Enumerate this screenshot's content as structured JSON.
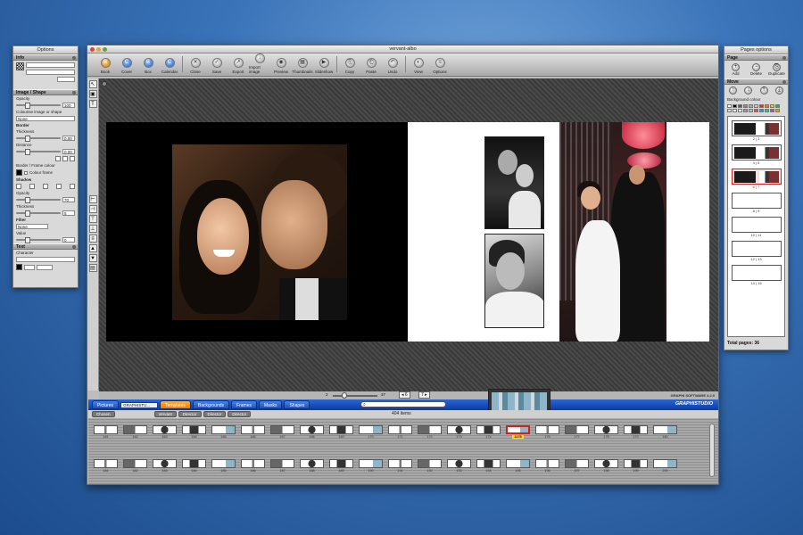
{
  "main_window": {
    "title": "vervant-albo",
    "toolbar": [
      {
        "name": "book",
        "label": "Book",
        "style": "orange",
        "glyph": "B"
      },
      {
        "name": "cover",
        "label": "Cover",
        "style": "blue",
        "glyph": "C"
      },
      {
        "name": "box",
        "label": "Box",
        "style": "blue",
        "glyph": "B"
      },
      {
        "name": "calendar",
        "label": "Calendar",
        "style": "blue",
        "glyph": "C"
      },
      {
        "name": "close",
        "label": "Close",
        "style": "",
        "glyph": "✕"
      },
      {
        "name": "save",
        "label": "Save",
        "style": "",
        "glyph": "✓"
      },
      {
        "name": "export",
        "label": "Export",
        "style": "",
        "glyph": "↗"
      },
      {
        "name": "import-image",
        "label": "Import image",
        "style": "",
        "glyph": "↓"
      },
      {
        "name": "preview",
        "label": "Preview",
        "style": "",
        "glyph": "◉"
      },
      {
        "name": "thumbnails",
        "label": "Thumbnails",
        "style": "",
        "glyph": "▦"
      },
      {
        "name": "slideshow",
        "label": "Slideshow",
        "style": "",
        "glyph": "▶"
      },
      {
        "name": "copy",
        "label": "Copy",
        "style": "",
        "glyph": "⎘"
      },
      {
        "name": "paste",
        "label": "Paste",
        "style": "",
        "glyph": "⎗"
      },
      {
        "name": "undo",
        "label": "Undo",
        "style": "",
        "glyph": "↶"
      },
      {
        "name": "view",
        "label": "View",
        "style": "",
        "glyph": "◐"
      },
      {
        "name": "options",
        "label": "Options",
        "style": "",
        "glyph": "≡"
      }
    ],
    "zoom": {
      "min": "2",
      "max": "37"
    },
    "page_nav": {
      "left": "6",
      "right": "7"
    },
    "credit": "GRAPHI SOFTWARE 4.2.0"
  },
  "bottom_panel": {
    "tabs": [
      "Pictures",
      "Templates",
      "Backgrounds",
      "Frames",
      "Masks",
      "Shapes"
    ],
    "active_tab": "Templates",
    "combo_value": "GRAPHISTU...",
    "subtabs": [
      "Chosen",
      "Vervant",
      "Director",
      "Director",
      "Director"
    ],
    "item_count": "404 items",
    "logo": "GRAPHISTUDIO",
    "row1": [
      "161",
      "162",
      "163",
      "164",
      "165",
      "166",
      "167",
      "168",
      "169",
      "170",
      "171",
      "172",
      "173",
      "174",
      "1175",
      "176",
      "177",
      "178",
      "179",
      "180"
    ],
    "row2": [
      "181",
      "182",
      "183",
      "184",
      "185",
      "186",
      "187",
      "188",
      "189",
      "190",
      "191",
      "192",
      "193",
      "194",
      "195",
      "196",
      "197",
      "198",
      "199",
      "200"
    ],
    "selected": "1175"
  },
  "options_palette": {
    "title": "Options",
    "info_head": "Info",
    "image_shape_head": "Image / Shape",
    "opacity_label": "Opacity",
    "opacity_value": "100",
    "colourise_label": "Colourise image or shape",
    "colourise_value": "None",
    "border_label": "Border",
    "thickness_label": "Thickness",
    "thickness_value": "0.00",
    "distance_label": "Distance",
    "distance_value": "0.00",
    "border_frame_label": "Border / Frame colour",
    "colour_frame_label": "Colour frame",
    "shadow_label": "Shadow",
    "shadow_opacity_label": "Opacity",
    "shadow_opacity_value": "70",
    "shadow_thickness_label": "Thickness",
    "shadow_thickness_value": "5",
    "filter_label": "Filter",
    "filter_value": "None",
    "value_label": "Value",
    "value_value": "0",
    "text_head": "Text",
    "character_label": "Character"
  },
  "pages_palette": {
    "title": "Pages options",
    "page_head": "Page",
    "buttons": [
      "Add",
      "Delete",
      "Duplicate"
    ],
    "move_head": "Move",
    "bg_colour_label": "Background colour",
    "colors": [
      "#ffffff",
      "#000000",
      "#555555",
      "#888888",
      "#aaaaaa",
      "#cccccc",
      "#c0392b",
      "#e67e22",
      "#f1c40f",
      "#27ae60",
      "#dddddd",
      "#ffffff",
      "#eeeeee",
      "#999999",
      "#bbbbbb",
      "#e74c3c",
      "#3498db",
      "#2ecc71",
      "#9b59b6",
      "#f39c12"
    ],
    "pages": [
      {
        "label": "2 | 3",
        "kind": "photo"
      },
      {
        "label": "4 | 5",
        "kind": "photo"
      },
      {
        "label": "6 | 7",
        "kind": "photo",
        "selected": true
      },
      {
        "label": "8 | 9",
        "kind": "empty"
      },
      {
        "label": "10 | 11",
        "kind": "empty"
      },
      {
        "label": "12 | 13",
        "kind": "empty"
      },
      {
        "label": "14 | 15",
        "kind": "empty"
      }
    ],
    "total_pages": "Total pages: 36"
  }
}
